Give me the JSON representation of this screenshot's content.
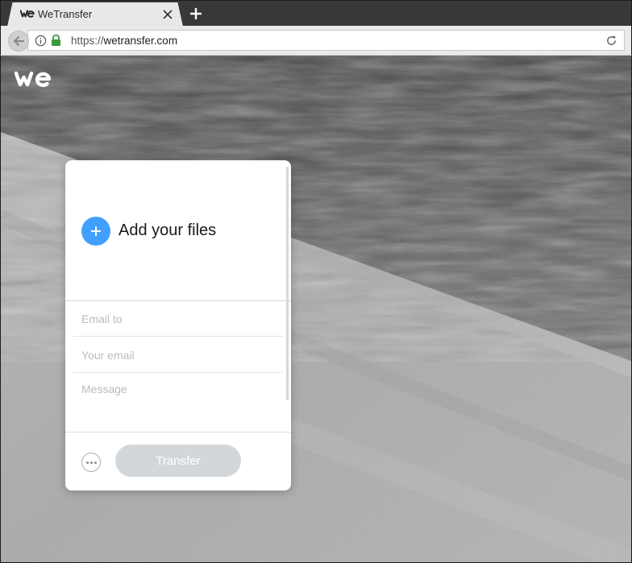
{
  "browser": {
    "tab": {
      "title": "WeTransfer",
      "favicon": "wetransfer-logo-icon"
    },
    "new_tab_icon": "plus-icon",
    "address": {
      "scheme": "https://",
      "host": "wetransfer.com"
    },
    "icons": [
      "back-arrow-icon",
      "info-icon",
      "lock-icon",
      "reload-icon",
      "close-icon"
    ],
    "lock_color": "#3c9a3a"
  },
  "page": {
    "logo": "wetransfer-logo-icon",
    "panel": {
      "add_files_label": "Add your files",
      "add_files_color": "#409fff",
      "fields": {
        "email_to_placeholder": "Email to",
        "your_email_placeholder": "Your email",
        "message_placeholder": "Message"
      },
      "more_options_icon": "more-options-icon",
      "transfer_label": "Transfer"
    }
  }
}
